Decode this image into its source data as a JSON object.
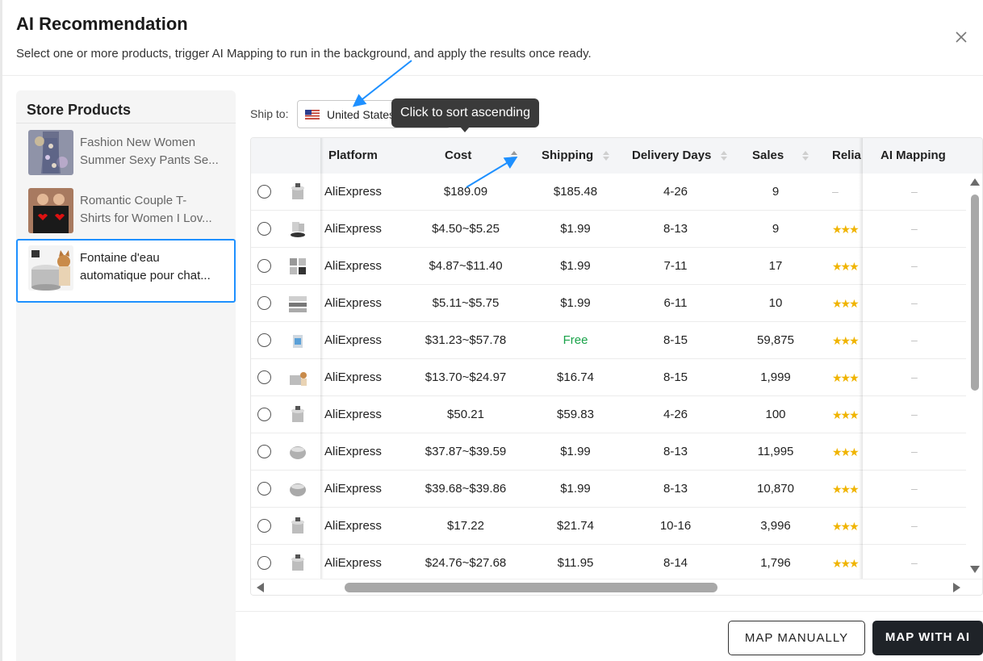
{
  "header": {
    "title": "AI Recommendation",
    "subtitle": "Select one or more products, trigger AI Mapping to run in the background, and apply the results once ready.",
    "close_icon": "close-icon"
  },
  "sidebar": {
    "title": "Store Products",
    "items": [
      {
        "name": "Fashion New Women Summer Sexy Pants Sets",
        "line1": "Fashion New Women",
        "line2": "Summer Sexy Pants Se...",
        "selected": false
      },
      {
        "name": "Romantic Couple T-Shirts for Women I Love",
        "line1": "Romantic Couple T-",
        "line2": "Shirts for Women I Lov...",
        "selected": false
      },
      {
        "name": "Fontaine d'eau automatique pour chat",
        "line1": "Fontaine d'eau",
        "line2": "automatique pour chat...",
        "selected": true
      }
    ]
  },
  "ship_to": {
    "label": "Ship to:",
    "value": "United States",
    "flag_icon": "us-flag-icon"
  },
  "tooltip": {
    "text": "Click to sort ascending"
  },
  "table": {
    "columns": {
      "platform": "Platform",
      "cost": "Cost",
      "shipping": "Shipping",
      "delivery": "Delivery Days",
      "sales": "Sales",
      "reliability": "Relia",
      "ai_mapping": "AI Mapping"
    },
    "rows": [
      {
        "platform": "AliExpress",
        "cost": "$189.09",
        "shipping": "$185.48",
        "delivery": "4-26",
        "sales": "9",
        "stars": "",
        "ai_mapping": "–"
      },
      {
        "platform": "AliExpress",
        "cost": "$4.50~$5.25",
        "shipping": "$1.99",
        "delivery": "8-13",
        "sales": "9",
        "stars": "★★★",
        "ai_mapping": "–"
      },
      {
        "platform": "AliExpress",
        "cost": "$4.87~$11.40",
        "shipping": "$1.99",
        "delivery": "7-11",
        "sales": "17",
        "stars": "★★★",
        "ai_mapping": "–"
      },
      {
        "platform": "AliExpress",
        "cost": "$5.11~$5.75",
        "shipping": "$1.99",
        "delivery": "6-11",
        "sales": "10",
        "stars": "★★★",
        "ai_mapping": "–"
      },
      {
        "platform": "AliExpress",
        "cost": "$31.23~$57.78",
        "shipping": "Free",
        "delivery": "8-15",
        "sales": "59,875",
        "stars": "★★★",
        "ai_mapping": "–"
      },
      {
        "platform": "AliExpress",
        "cost": "$13.70~$24.97",
        "shipping": "$16.74",
        "delivery": "8-15",
        "sales": "1,999",
        "stars": "★★★",
        "ai_mapping": "–"
      },
      {
        "platform": "AliExpress",
        "cost": "$50.21",
        "shipping": "$59.83",
        "delivery": "4-26",
        "sales": "100",
        "stars": "★★★",
        "ai_mapping": "–"
      },
      {
        "platform": "AliExpress",
        "cost": "$37.87~$39.59",
        "shipping": "$1.99",
        "delivery": "8-13",
        "sales": "11,995",
        "stars": "★★★",
        "ai_mapping": "–"
      },
      {
        "platform": "AliExpress",
        "cost": "$39.68~$39.86",
        "shipping": "$1.99",
        "delivery": "8-13",
        "sales": "10,870",
        "stars": "★★★",
        "ai_mapping": "–"
      },
      {
        "platform": "AliExpress",
        "cost": "$17.22",
        "shipping": "$21.74",
        "delivery": "10-16",
        "sales": "3,996",
        "stars": "★★★",
        "ai_mapping": "–"
      },
      {
        "platform": "AliExpress",
        "cost": "$24.76~$27.68",
        "shipping": "$11.95",
        "delivery": "8-14",
        "sales": "1,796",
        "stars": "★★★",
        "ai_mapping": "–"
      }
    ]
  },
  "footer": {
    "map_manually": "MAP MANUALLY",
    "map_with_ai": "MAP WITH AI"
  },
  "colors": {
    "accent_blue": "#1e90ff",
    "free_green": "#1aa34a",
    "star_gold": "#f0b400",
    "primary_button": "#1f2328"
  }
}
